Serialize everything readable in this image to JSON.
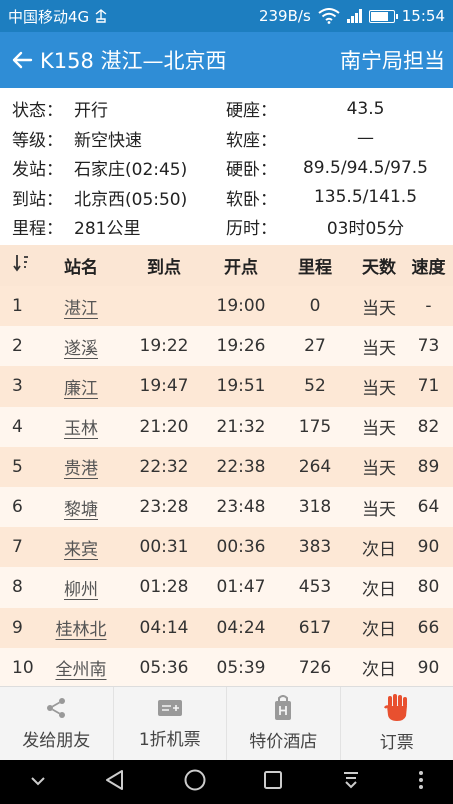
{
  "status_bar": {
    "carrier": "中国移动4G",
    "speed": "239B/s",
    "time": "15:54"
  },
  "header": {
    "title": "K158 湛江—北京西",
    "bureau": "南宁局担当"
  },
  "info": [
    {
      "k1": "状态：",
      "v1": "开行",
      "k2": "硬座：",
      "v2": "43.5"
    },
    {
      "k1": "等级：",
      "v1": "新空快速",
      "k2": "软座：",
      "v2": "—"
    },
    {
      "k1": "发站：",
      "v1": "石家庄(02:45)",
      "k2": "硬卧：",
      "v2": "89.5/94.5/97.5"
    },
    {
      "k1": "到站：",
      "v1": "北京西(05:50)",
      "k2": "软卧：",
      "v2": "135.5/141.5"
    },
    {
      "k1": "里程：",
      "v1": "281公里",
      "k2": "历时：",
      "v2": "03时05分"
    }
  ],
  "table": {
    "headers": {
      "station": "站名",
      "arrive": "到点",
      "depart": "开点",
      "km": "里程",
      "day": "天数",
      "speed": "速度"
    },
    "rows": [
      {
        "no": "1",
        "station": "湛江",
        "arrive": "",
        "depart": "19:00",
        "km": "0",
        "day": "当天",
        "speed": "-"
      },
      {
        "no": "2",
        "station": "遂溪",
        "arrive": "19:22",
        "depart": "19:26",
        "km": "27",
        "day": "当天",
        "speed": "73"
      },
      {
        "no": "3",
        "station": "廉江",
        "arrive": "19:47",
        "depart": "19:51",
        "km": "52",
        "day": "当天",
        "speed": "71"
      },
      {
        "no": "4",
        "station": "玉林",
        "arrive": "21:20",
        "depart": "21:32",
        "km": "175",
        "day": "当天",
        "speed": "82"
      },
      {
        "no": "5",
        "station": "贵港",
        "arrive": "22:32",
        "depart": "22:38",
        "km": "264",
        "day": "当天",
        "speed": "89"
      },
      {
        "no": "6",
        "station": "黎塘",
        "arrive": "23:28",
        "depart": "23:48",
        "km": "318",
        "day": "当天",
        "speed": "64"
      },
      {
        "no": "7",
        "station": "来宾",
        "arrive": "00:31",
        "depart": "00:36",
        "km": "383",
        "day": "次日",
        "speed": "90"
      },
      {
        "no": "8",
        "station": "柳州",
        "arrive": "01:28",
        "depart": "01:47",
        "km": "453",
        "day": "次日",
        "speed": "80"
      },
      {
        "no": "9",
        "station": "桂林北",
        "arrive": "04:14",
        "depart": "04:24",
        "km": "617",
        "day": "次日",
        "speed": "66"
      },
      {
        "no": "10",
        "station": "全州南",
        "arrive": "05:36",
        "depart": "05:39",
        "km": "726",
        "day": "次日",
        "speed": "90"
      }
    ]
  },
  "tabs": [
    {
      "label": "发给朋友",
      "icon": "share-icon"
    },
    {
      "label": "1折机票",
      "icon": "ticket-icon"
    },
    {
      "label": "特价酒店",
      "icon": "hotel-icon"
    },
    {
      "label": "订票",
      "icon": "hand-icon"
    }
  ],
  "colors": {
    "status_bar": "#1d7ec0",
    "app_bar": "#2f8dd6",
    "row_odd": "#fde8d6",
    "row_even": "#fff6ee",
    "accent": "#e8502f"
  }
}
